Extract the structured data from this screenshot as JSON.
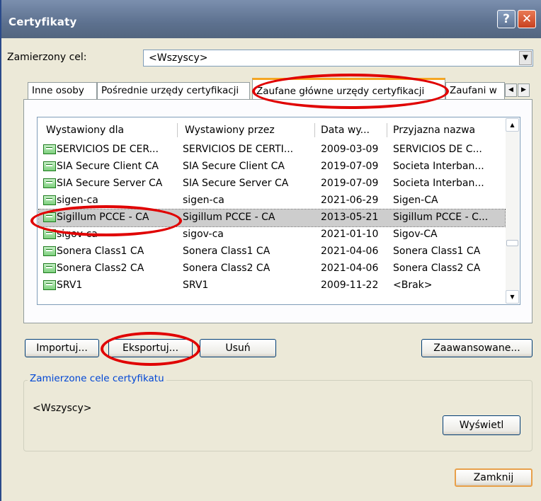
{
  "window": {
    "title": "Certyfikaty",
    "help_glyph": "?",
    "close_glyph": "✕"
  },
  "purpose": {
    "label": "Zamierzony cel:",
    "value": "<Wszyscy>"
  },
  "tabs": [
    {
      "label": "Inne osoby"
    },
    {
      "label": "Pośrednie urzędy certyfikacji"
    },
    {
      "label": "Zaufane główne urzędy certyfikacji",
      "active": true
    },
    {
      "label": "Zaufani w"
    }
  ],
  "list": {
    "columns": [
      "Wystawiony dla",
      "Wystawiony przez",
      "Data wy...",
      "Przyjazna nazwa"
    ],
    "rows": [
      {
        "issued_to": "SERVICIOS DE CER...",
        "issued_by": "SERVICIOS DE CERTI...",
        "date": "2009-03-09",
        "friendly": "SERVICIOS DE C..."
      },
      {
        "issued_to": "SIA Secure Client CA",
        "issued_by": "SIA Secure Client CA",
        "date": "2019-07-09",
        "friendly": "Societa Interban..."
      },
      {
        "issued_to": "SIA Secure Server CA",
        "issued_by": "SIA Secure Server CA",
        "date": "2019-07-09",
        "friendly": "Societa Interban..."
      },
      {
        "issued_to": "sigen-ca",
        "issued_by": "sigen-ca",
        "date": "2021-06-29",
        "friendly": "Sigen-CA"
      },
      {
        "issued_to": "Sigillum PCCE - CA",
        "issued_by": "Sigillum PCCE - CA",
        "date": "2013-05-21",
        "friendly": "Sigillum PCCE - C...",
        "selected": true
      },
      {
        "issued_to": "sigov-ca",
        "issued_by": "sigov-ca",
        "date": "2021-01-10",
        "friendly": "Sigov-CA"
      },
      {
        "issued_to": "Sonera Class1 CA",
        "issued_by": "Sonera Class1 CA",
        "date": "2021-04-06",
        "friendly": "Sonera Class1 CA"
      },
      {
        "issued_to": "Sonera Class2 CA",
        "issued_by": "Sonera Class2 CA",
        "date": "2021-04-06",
        "friendly": "Sonera Class2 CA"
      },
      {
        "issued_to": "SRV1",
        "issued_by": "SRV1",
        "date": "2009-11-22",
        "friendly": "<Brak>"
      }
    ]
  },
  "buttons": {
    "import": "Importuj...",
    "export": "Eksportuj...",
    "remove": "Usuń",
    "advanced": "Zaawansowane...",
    "view": "Wyświetl",
    "close": "Zamknij"
  },
  "purposes_group": {
    "title": "Zamierzone cele certyfikatu",
    "value": "<Wszyscy>"
  },
  "colors": {
    "annotation": "#e00000",
    "titlebar": "#5d718f",
    "group_title": "#0046d5",
    "tab_highlight": "#f5a623"
  }
}
